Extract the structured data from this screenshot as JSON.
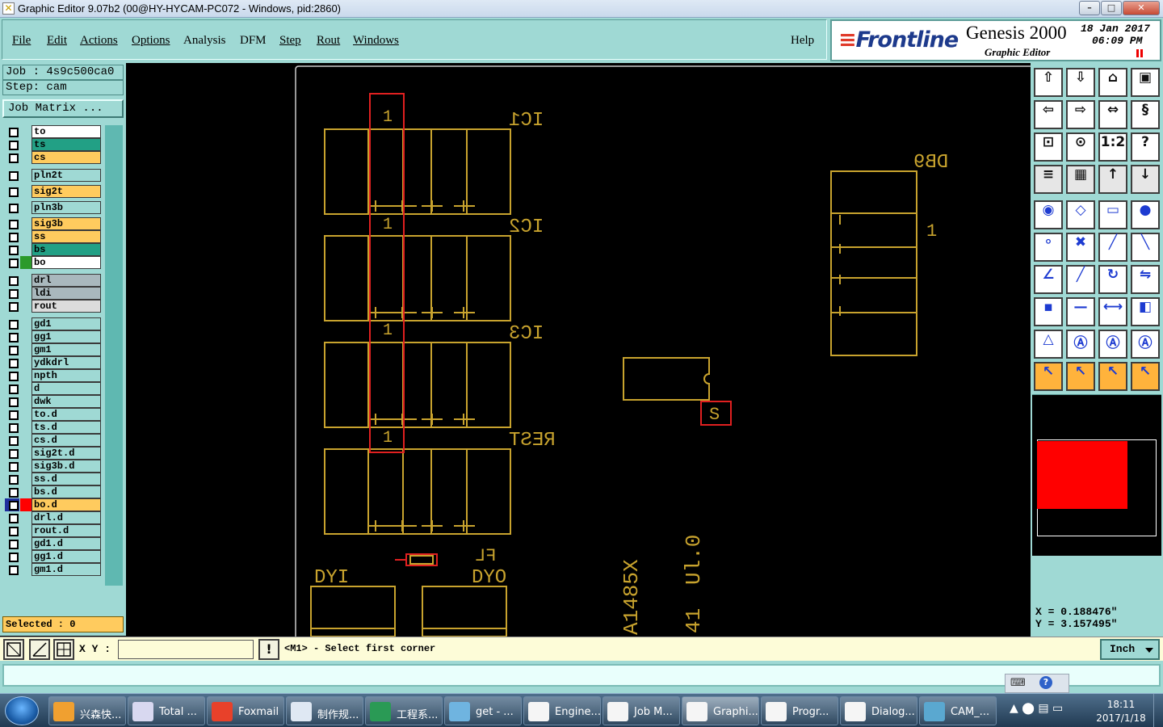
{
  "window": {
    "title": "Graphic Editor 9.07b2 (00@HY-HYCAM-PC072 - Windows, pid:2860)",
    "min_label": "–",
    "max_label": "□",
    "close_label": "✕"
  },
  "menu": {
    "items": [
      "File",
      "Edit",
      "Actions",
      "Options",
      "Analysis",
      "DFM",
      "Step",
      "Rout",
      "Windows"
    ],
    "help": "Help"
  },
  "brand": {
    "logo_prefix": "Fr",
    "logo_rest": "ontline",
    "name": "Genesis 2000",
    "sub": "Graphic Editor",
    "date": "18 Jan 2017",
    "time": "06:09 PM"
  },
  "job": {
    "job_line": "Job : 4s9c500ca0",
    "step_line": "Step: cam",
    "matrix_button": "Job Matrix ...",
    "selected": "Selected : 0"
  },
  "layers": [
    {
      "name": "to",
      "color": "#ffffff",
      "swatch": ""
    },
    {
      "name": "ts",
      "color": "#22a085",
      "swatch": ""
    },
    {
      "name": "cs",
      "color": "#ffcb5e",
      "swatch": ""
    },
    {
      "name": "pln2t",
      "color": "#9fd9d4",
      "swatch": ""
    },
    {
      "name": "sig2t",
      "color": "#ffcb5e",
      "swatch": ""
    },
    {
      "name": "pln3b",
      "color": "#9fd9d4",
      "swatch": ""
    },
    {
      "name": "sig3b",
      "color": "#ffcb5e",
      "swatch": ""
    },
    {
      "name": "ss",
      "color": "#ffcb5e",
      "swatch": ""
    },
    {
      "name": "bs",
      "color": "#22a085",
      "swatch": ""
    },
    {
      "name": "bo",
      "color": "#ffffff",
      "swatch": "#2b9a2b"
    },
    {
      "name": "drl",
      "color": "#a9b8bd",
      "swatch": ""
    },
    {
      "name": "ldi",
      "color": "#a9b8bd",
      "swatch": ""
    },
    {
      "name": "rout",
      "color": "#dcdcdc",
      "swatch": ""
    },
    {
      "name": "gd1",
      "color": "#9fd9d4",
      "swatch": ""
    },
    {
      "name": "gg1",
      "color": "#9fd9d4",
      "swatch": ""
    },
    {
      "name": "gm1",
      "color": "#9fd9d4",
      "swatch": ""
    },
    {
      "name": "ydkdrl",
      "color": "#9fd9d4",
      "swatch": ""
    },
    {
      "name": "npth",
      "color": "#9fd9d4",
      "swatch": ""
    },
    {
      "name": "d",
      "color": "#9fd9d4",
      "swatch": ""
    },
    {
      "name": "dwk",
      "color": "#9fd9d4",
      "swatch": ""
    },
    {
      "name": "to.d",
      "color": "#9fd9d4",
      "swatch": ""
    },
    {
      "name": "ts.d",
      "color": "#9fd9d4",
      "swatch": ""
    },
    {
      "name": "cs.d",
      "color": "#9fd9d4",
      "swatch": ""
    },
    {
      "name": "sig2t.d",
      "color": "#9fd9d4",
      "swatch": ""
    },
    {
      "name": "sig3b.d",
      "color": "#9fd9d4",
      "swatch": ""
    },
    {
      "name": "ss.d",
      "color": "#9fd9d4",
      "swatch": ""
    },
    {
      "name": "bs.d",
      "color": "#9fd9d4",
      "swatch": ""
    },
    {
      "name": "bo.d",
      "color": "#ffcb5e",
      "swatch": "#ff0000",
      "active": true
    },
    {
      "name": "drl.d",
      "color": "#9fd9d4",
      "swatch": ""
    },
    {
      "name": "rout.d",
      "color": "#9fd9d4",
      "swatch": ""
    },
    {
      "name": "gd1.d",
      "color": "#9fd9d4",
      "swatch": ""
    },
    {
      "name": "gg1.d",
      "color": "#9fd9d4",
      "swatch": ""
    },
    {
      "name": "gm1.d",
      "color": "#9fd9d4",
      "swatch": ""
    }
  ],
  "canvas_labels": {
    "ic1": "IC1",
    "ic2": "IC2",
    "ic3": "IC3",
    "rest": "REST",
    "db9": "DB9",
    "pin1": "1",
    "s": "S",
    "dyi": "DYI",
    "dyo": "DYO",
    "fl": "FL",
    "part": "A1485X",
    "ver": "Ul.0",
    "num": "41"
  },
  "coords": {
    "x": "X = 0.188476\"",
    "y": "Y = 3.157495\""
  },
  "command": {
    "xy_label": "X Y :",
    "xy_value": "",
    "exclaim": "!",
    "prompt": "<M1> - Select first corner",
    "unit": "Inch"
  },
  "taskbar": {
    "items": [
      {
        "label": "兴森快...",
        "color": "#f0a030"
      },
      {
        "label": "Total ...",
        "color": "#d8d8f0"
      },
      {
        "label": "Foxmail",
        "color": "#e8412a"
      },
      {
        "label": "制作规...",
        "color": "#dfe8f3"
      },
      {
        "label": "工程系...",
        "color": "#2a9a55"
      },
      {
        "label": "get - ...",
        "color": "#6fb4e0"
      },
      {
        "label": "Engine...",
        "color": "#f5f5f5"
      },
      {
        "label": "Job M...",
        "color": "#f5f5f5"
      },
      {
        "label": "Graphi...",
        "color": "#f5f5f5"
      },
      {
        "label": "Progr...",
        "color": "#f5f5f5"
      },
      {
        "label": "Dialog...",
        "color": "#f5f5f5"
      },
      {
        "label": "CAM_...",
        "color": "#5aa8d0"
      }
    ],
    "time": "18:11",
    "date": "2017/1/18"
  }
}
